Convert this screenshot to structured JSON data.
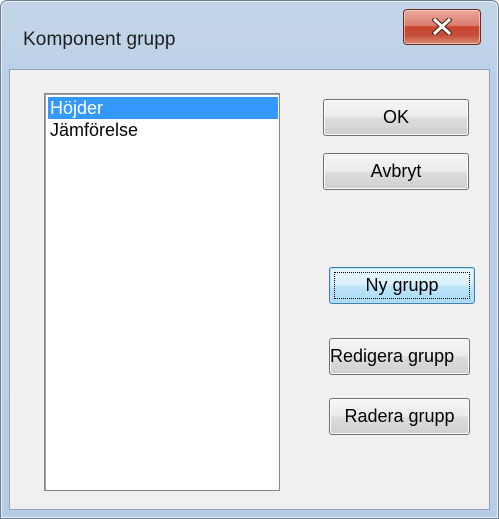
{
  "window": {
    "title": "Komponent grupp",
    "close_label": "x"
  },
  "list": {
    "items": [
      {
        "label": "Höjder",
        "selected": true
      },
      {
        "label": "Jämförelse",
        "selected": false
      }
    ]
  },
  "buttons": {
    "ok": "OK",
    "cancel": "Avbryt",
    "new_group": "Ny grupp",
    "edit_group": "Redigera grupp",
    "delete_group": "Radera grupp"
  },
  "colors": {
    "selection": "#3399ff",
    "close_button": "#c8432d"
  },
  "icons": {
    "close": "close-icon"
  }
}
